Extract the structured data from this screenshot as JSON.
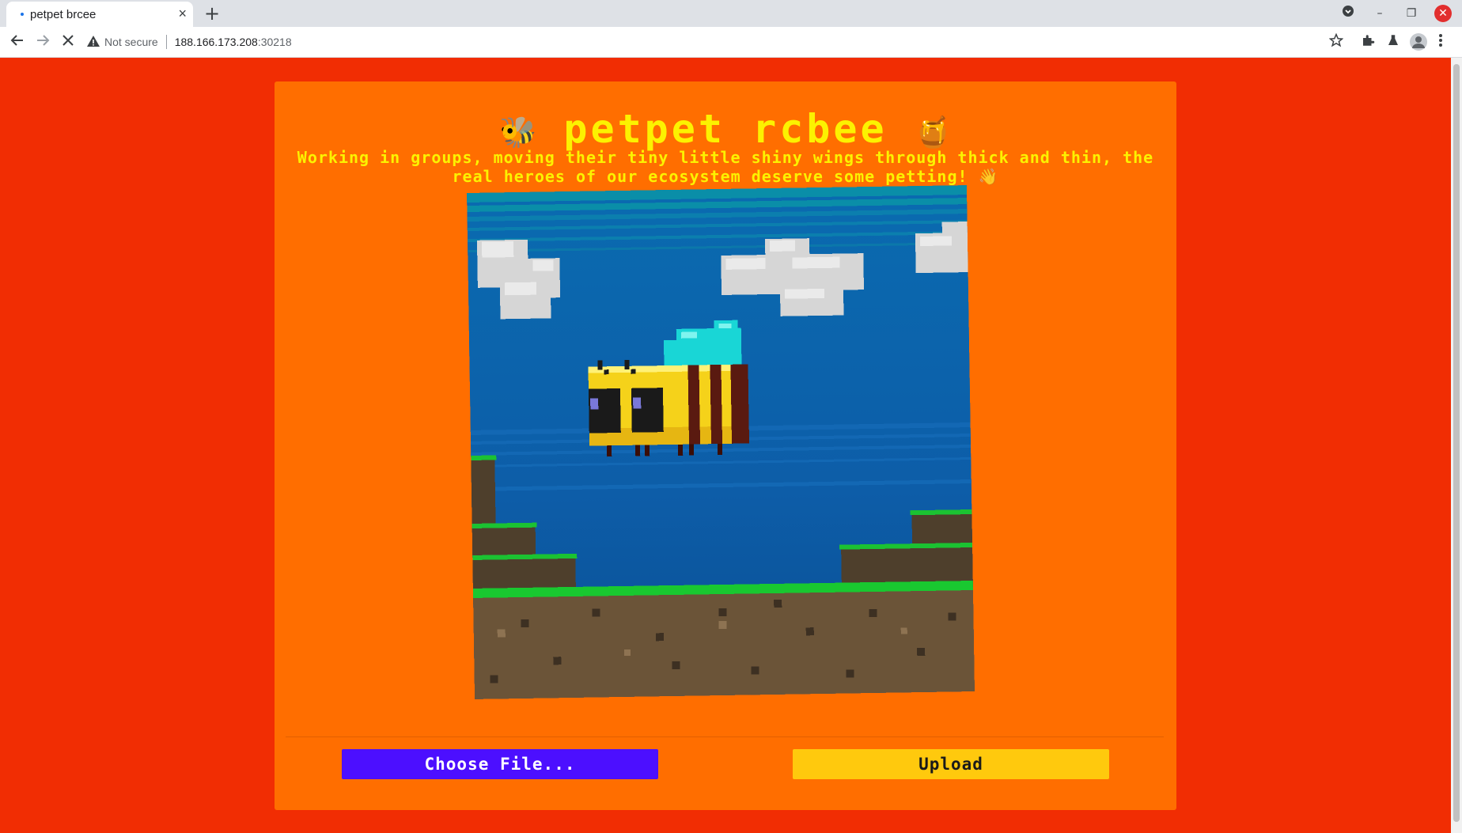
{
  "browser": {
    "tab_title": "petpet brcee",
    "tab_close": "×",
    "new_tab": "+",
    "security_label": "Not secure",
    "url_host": "188.166.173.208",
    "url_port": ":30218"
  },
  "page": {
    "title": "petpet rcbee",
    "title_emoji_left": "🐝",
    "title_emoji_right": "🍯",
    "subtitle": "Working in groups, moving their tiny little shiny wings through thick and thin, the real heroes of our ecosystem deserve some petting! 👋",
    "choose_file_label": "Choose File...",
    "upload_label": "Upload"
  },
  "colors": {
    "page_background": "#f12d03",
    "card_background": "#ff6e00",
    "title_text": "#fcf200",
    "choose_button": "#4c0fff",
    "upload_button": "#ffc90d"
  },
  "icons": {
    "back": "arrow-left-icon",
    "forward": "arrow-right-icon",
    "stop": "close-icon",
    "warning": "warning-icon",
    "bookmark": "star-icon",
    "extensions": "puzzle-icon",
    "labs": "flask-icon",
    "profile": "avatar-icon",
    "menu": "kebab-menu-icon"
  }
}
